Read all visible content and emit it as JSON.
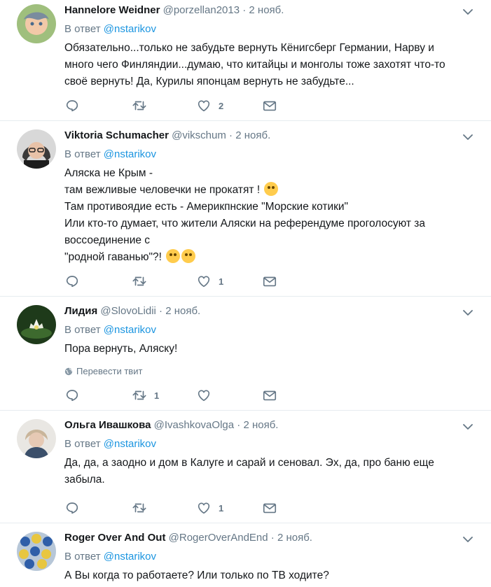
{
  "tweets": [
    {
      "name": "Hannelore Weidner",
      "handle": "@porzellan2013",
      "dot": "·",
      "time": "2 нояб.",
      "reply_prefix": "В ответ",
      "reply_mention": "@nstarikov",
      "text": "Обязательно...только не забудьте вернуть Кёнигсберг Германии, Нарву и\nмного чего Финляндии...думаю, что китайцы и монголы тоже захотят что-то\nсвоё вернуть! Да, Курилы японцам вернуть не забудьте...",
      "retweets": "",
      "likes": "2"
    },
    {
      "name": "Viktoria Schumacher",
      "handle": "@vikschum",
      "dot": "·",
      "time": "2 нояб.",
      "reply_prefix": "В ответ",
      "reply_mention": "@nstarikov",
      "text_lines": [
        "Аляска не Крым -",
        "там вежливые человечки не прокатят !",
        "Там противоядие есть - Америкпнские \"Морские котики\"",
        "Или кто-то думает, что жители Аляски на референдуме проголосуют за",
        "воссоединение с",
        "\"родной гаванью\"?!"
      ],
      "emoji_1": "joy-emoji",
      "emoji_2": "monocle-emoji",
      "emoji_3": "nerd-emoji",
      "retweets": "",
      "likes": "1"
    },
    {
      "name": "Лидия",
      "handle": "@SlovoLidii",
      "dot": "·",
      "time": "2 нояб.",
      "reply_prefix": "В ответ",
      "reply_mention": "@nstarikov",
      "text": "Пора вернуть, Аляску!",
      "translate": "Перевести твит",
      "retweets": "1",
      "likes": ""
    },
    {
      "name": "Ольга Ивашкова",
      "handle": "@IvashkovaOlga",
      "dot": "·",
      "time": "2 нояб.",
      "reply_prefix": "В ответ",
      "reply_mention": "@nstarikov",
      "text": "Да, да, а заодно и дом в Калуге и сарай и сеновал. Эх, да, про баню еще\nзабыла.",
      "retweets": "",
      "likes": "1"
    },
    {
      "name": "Roger Over And Out",
      "handle": "@RogerOverAndEnd",
      "dot": "·",
      "time": "2 нояб.",
      "reply_prefix": "В ответ",
      "reply_mention": "@nstarikov",
      "text": "А Вы когда то работаете? Или только по ТВ ходите?"
    }
  ],
  "colors": {
    "link": "#1b95e0",
    "secondary": "#657786",
    "divider": "#e6ecf0"
  },
  "icons": {
    "reply": "reply-icon",
    "retweet": "retweet-icon",
    "like": "heart-icon",
    "dm": "envelope-icon",
    "caret": "chevron-down-icon",
    "globe": "globe-icon"
  }
}
